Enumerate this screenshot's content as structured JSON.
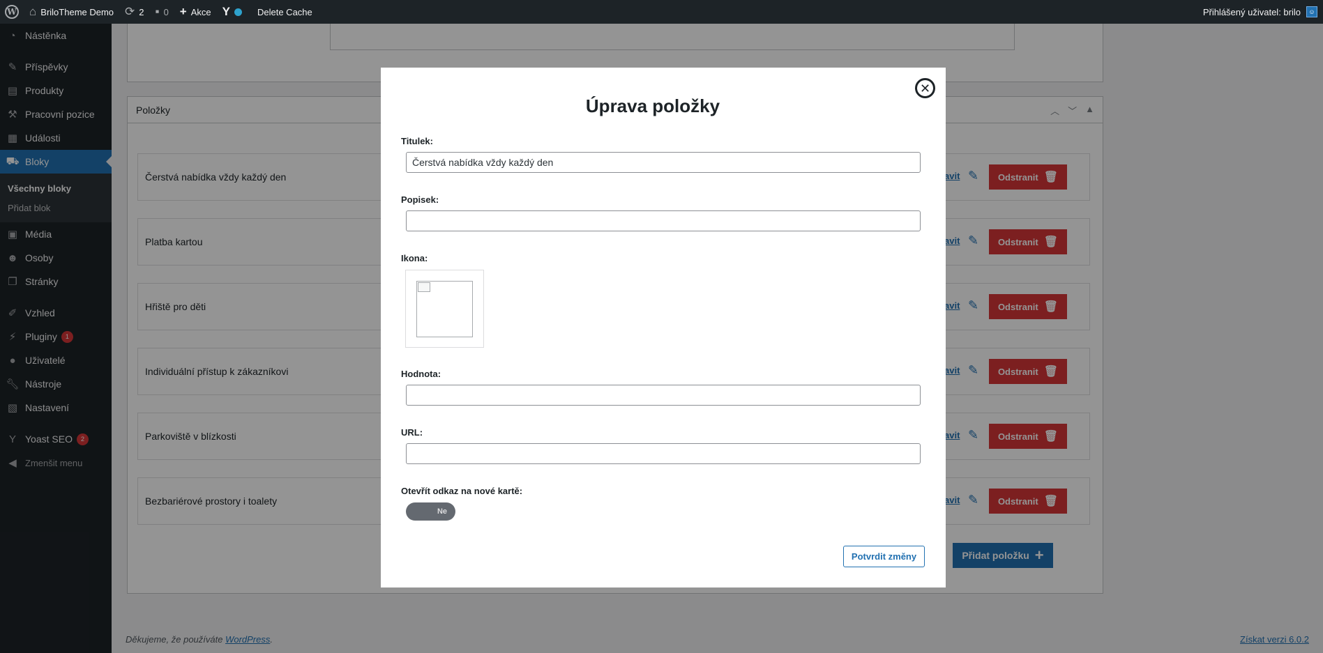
{
  "adminbar": {
    "site_name": "BriloTheme Demo",
    "updates_count": "2",
    "comments_count": "0",
    "new_label": "Akce",
    "cache_label": "Delete Cache",
    "user_greeting": "Přihlášený uživatel: brilo"
  },
  "sidebar": {
    "items": [
      {
        "label": "Nástěnka",
        "icon": "dashboard-icon"
      },
      {
        "label": "Příspěvky",
        "icon": "pin-icon"
      },
      {
        "label": "Produkty",
        "icon": "archive-icon"
      },
      {
        "label": "Pracovní pozice",
        "icon": "hammer-icon"
      },
      {
        "label": "Události",
        "icon": "calendar-icon"
      },
      {
        "label": "Bloky",
        "icon": "cart-icon"
      },
      {
        "label": "Média",
        "icon": "media-icon"
      },
      {
        "label": "Osoby",
        "icon": "people-icon"
      },
      {
        "label": "Stránky",
        "icon": "pages-icon"
      },
      {
        "label": "Vzhled",
        "icon": "brush-icon"
      },
      {
        "label": "Pluginy",
        "icon": "plugin-icon",
        "badge": "1"
      },
      {
        "label": "Uživatelé",
        "icon": "user-icon"
      },
      {
        "label": "Nástroje",
        "icon": "wrench-icon"
      },
      {
        "label": "Nastavení",
        "icon": "settings-icon"
      },
      {
        "label": "Yoast SEO",
        "icon": "yoast-icon",
        "badge": "2"
      },
      {
        "label": "Zmenšit menu",
        "icon": "collapse-icon"
      }
    ],
    "submenu": {
      "all_blocks": "Všechny bloky",
      "add_block": "Přidat blok"
    }
  },
  "items_box": {
    "title": "Položky",
    "rows": [
      {
        "title": "Čerstvá nabídka vždy každý den"
      },
      {
        "title": "Platba kartou"
      },
      {
        "title": "Hřiště pro děti"
      },
      {
        "title": "Individuální přístup k zákazníkovi"
      },
      {
        "title": "Parkoviště v blízkosti"
      },
      {
        "title": "Bezbariérové prostory i toalety"
      }
    ],
    "edit_label": "avit",
    "delete_label": "Odstranit",
    "add_label": "Přidat položku"
  },
  "footer": {
    "thanks_prefix": "Děkujeme, že používáte ",
    "thanks_link": "WordPress",
    "thanks_suffix": ".",
    "version_link": "Získat verzi 6.0.2"
  },
  "modal": {
    "title": "Úprava položky",
    "fields": {
      "title_label": "Titulek:",
      "title_value": "Čerstvá nabídka vždy každý den",
      "desc_label": "Popisek:",
      "desc_value": "",
      "icon_label": "Ikona:",
      "value_label": "Hodnota:",
      "value_value": "",
      "url_label": "URL:",
      "url_value": "",
      "newtab_label": "Otevřít odkaz na nové kartě:",
      "newtab_state": "Ne"
    },
    "confirm_label": "Potvrdit změny"
  },
  "colors": {
    "admin_dark": "#1d2327",
    "accent_blue": "#2271b1",
    "danger_red": "#d63638"
  }
}
